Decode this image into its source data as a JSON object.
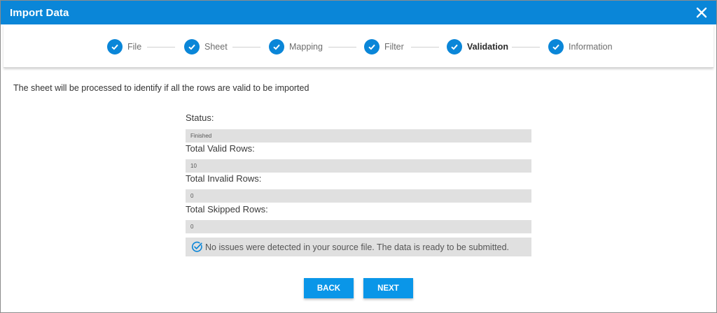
{
  "dialog": {
    "title": "Import Data"
  },
  "steps": [
    {
      "label": "File"
    },
    {
      "label": "Sheet"
    },
    {
      "label": "Mapping"
    },
    {
      "label": "Filter"
    },
    {
      "label": "Validation"
    },
    {
      "label": "Information"
    }
  ],
  "active_step": "Validation",
  "intro": "The sheet will be processed to identify if all the rows are valid to be imported",
  "fields": {
    "status": {
      "label": "Status:",
      "value": "Finished"
    },
    "valid": {
      "label": "Total Valid Rows:",
      "value": "10"
    },
    "invalid": {
      "label": "Total Invalid Rows:",
      "value": "0"
    },
    "skipped": {
      "label": "Total Skipped Rows:",
      "value": "0"
    }
  },
  "notice": "No issues were detected in your source file. The data is ready to be submitted.",
  "buttons": {
    "back": "BACK",
    "next": "NEXT"
  },
  "colors": {
    "accent": "#0a86d8",
    "button": "#0a96e8",
    "field_bg": "#e0e0e0"
  }
}
